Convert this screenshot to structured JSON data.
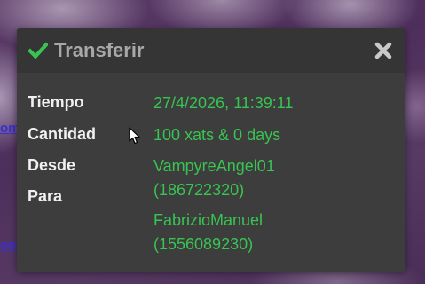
{
  "background": {
    "link_one": "om",
    "link_two": "om"
  },
  "dialog": {
    "title": "Transferir",
    "icons": {
      "title_icon": "check-icon",
      "close": "close-icon"
    },
    "rows": {
      "time_label": "Tiempo",
      "time_value": "27/4/2026, 11:39:11",
      "amount_label": "Cantidad",
      "amount_value": "100 xats & 0 days",
      "from_label": "Desde",
      "from_name": "VampyreAngel01",
      "from_id": "(186722320)",
      "to_label": "Para",
      "to_name": "FabrizioManuel",
      "to_id": "(1556089230)"
    },
    "colors": {
      "accent_green": "#38c451",
      "title_gray": "#a8a8a8",
      "panel": "#3d3d3d",
      "titlebar": "#353535"
    }
  }
}
